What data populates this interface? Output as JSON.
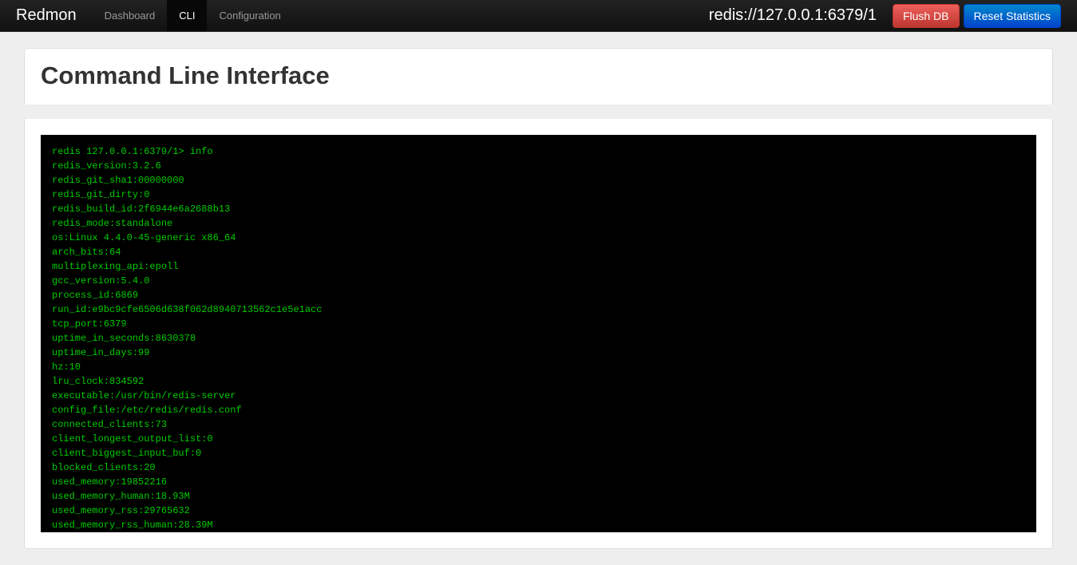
{
  "navbar": {
    "brand": "Redmon",
    "items": [
      {
        "label": "Dashboard",
        "active": false
      },
      {
        "label": "CLI",
        "active": true
      },
      {
        "label": "Configuration",
        "active": false
      }
    ],
    "connection": "redis://127.0.0.1:6379/1",
    "flush_label": "Flush DB",
    "reset_label": "Reset Statistics"
  },
  "page": {
    "title": "Command Line Interface"
  },
  "terminal": {
    "prompt": "redis 127.0.0.1:6379/1> info",
    "lines": [
      "redis_version:3.2.6",
      "redis_git_sha1:00000000",
      "redis_git_dirty:0",
      "redis_build_id:2f6944e6a2688b13",
      "redis_mode:standalone",
      "os:Linux 4.4.0-45-generic x86_64",
      "arch_bits:64",
      "multiplexing_api:epoll",
      "gcc_version:5.4.0",
      "process_id:6869",
      "run_id:e9bc9cfe6506d638f062d8940713562c1e5e1acc",
      "tcp_port:6379",
      "uptime_in_seconds:8630378",
      "uptime_in_days:99",
      "hz:10",
      "lru_clock:834592",
      "executable:/usr/bin/redis-server",
      "config_file:/etc/redis/redis.conf",
      "connected_clients:73",
      "client_longest_output_list:0",
      "client_biggest_input_buf:0",
      "blocked_clients:20",
      "used_memory:19852216",
      "used_memory_human:18.93M",
      "used_memory_rss:29765632",
      "used_memory_rss_human:28.39M"
    ]
  }
}
